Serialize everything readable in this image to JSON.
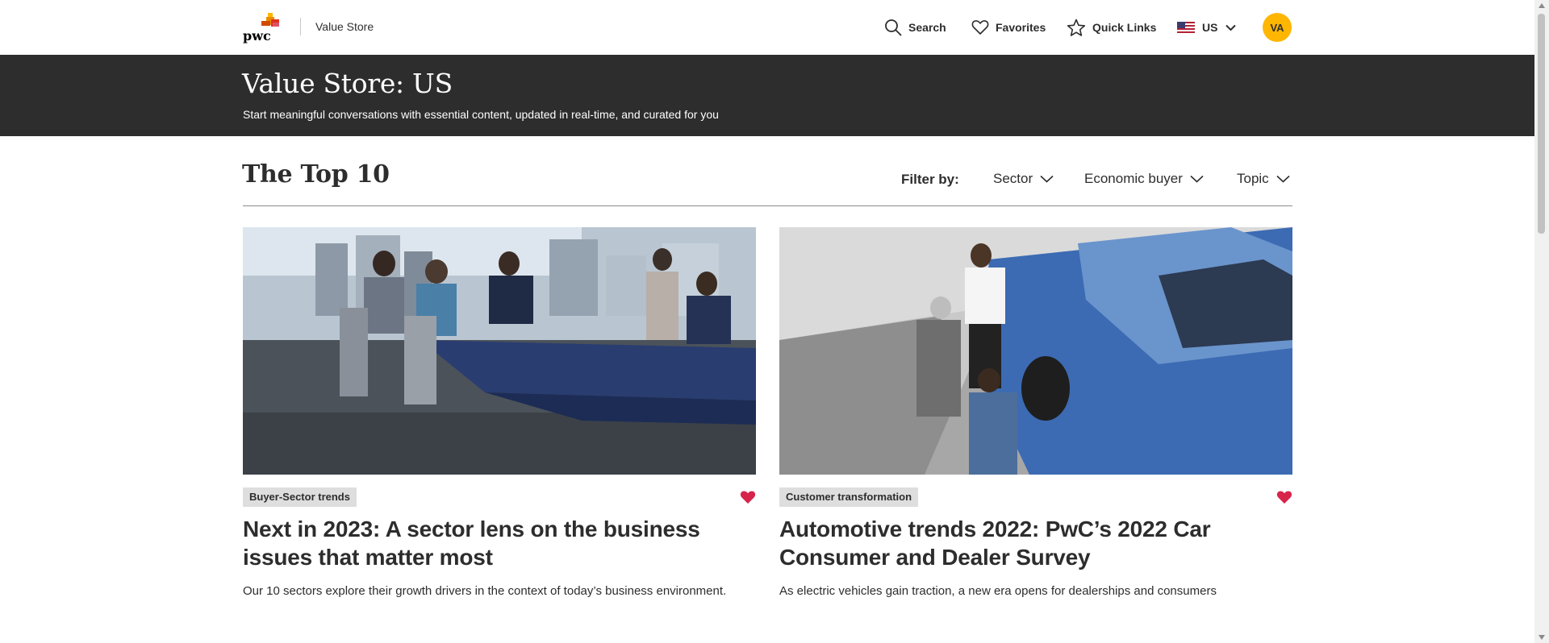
{
  "header": {
    "logo_text": "pwc",
    "site_name": "Value Store",
    "search_label": "Search",
    "favorites_label": "Favorites",
    "quick_links_label": "Quick Links",
    "country_label": "US",
    "avatar_initials": "VA"
  },
  "hero": {
    "title": "Value Store: US",
    "subtitle": "Start meaningful conversations with essential content, updated in real-time, and curated for you"
  },
  "section": {
    "title": "The Top 10",
    "filter_label": "Filter by:",
    "filters": [
      "Sector",
      "Economic buyer",
      "Topic"
    ]
  },
  "cards": [
    {
      "tag": "Buyer-Sector trends",
      "title": "Next in 2023: A sector lens on the business issues that matter most",
      "description": "Our 10 sectors explore their growth drivers in the context of today’s business environment.",
      "favorited": true
    },
    {
      "tag": "Customer transformation",
      "title": "Automotive trends 2022: PwC’s 2022 Car Consumer and Dealer Survey",
      "description": "As electric vehicles gain traction, a new era opens for dealerships and consumers",
      "favorited": true
    }
  ],
  "colors": {
    "accent_yellow": "#ffb600",
    "brand_orange": "#d04a02",
    "brand_red": "#e0301e",
    "dark_band": "#2d2d2d",
    "heart_red": "#d6244b",
    "tag_bg": "#dedede"
  },
  "icons": [
    "pwc-logo",
    "search-icon",
    "heart-outline-icon",
    "star-outline-icon",
    "us-flag-icon",
    "chevron-down-icon",
    "heart-filled-icon"
  ]
}
